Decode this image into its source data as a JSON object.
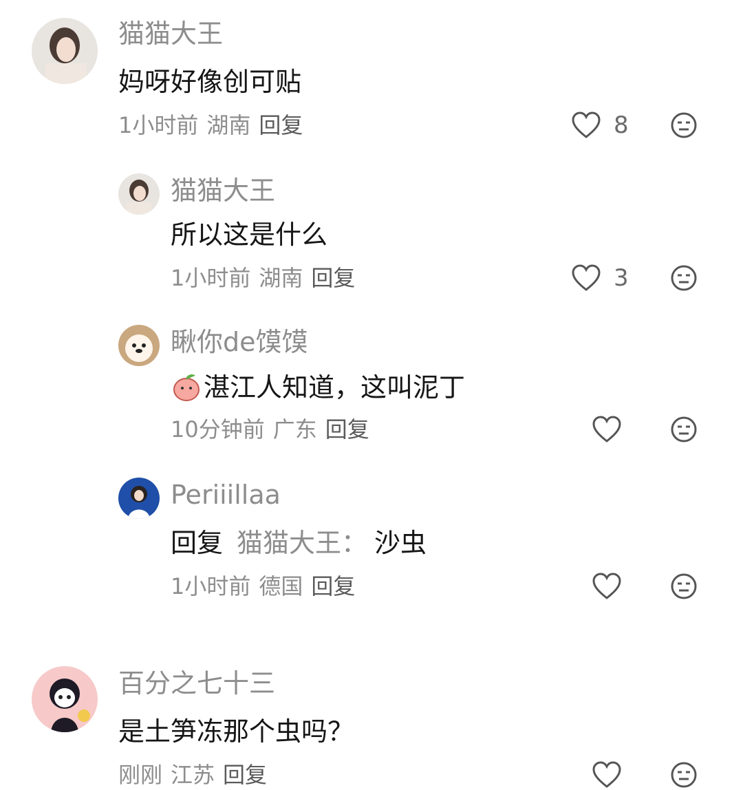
{
  "comments": [
    {
      "name": "猫猫大王",
      "text": "妈呀好像创可贴",
      "time": "1小时前",
      "location": "湖南",
      "reply_label": "回复",
      "likes": "8"
    },
    {
      "name": "猫猫大王",
      "text": "所以这是什么",
      "time": "1小时前",
      "location": "湖南",
      "reply_label": "回复",
      "likes": "3"
    },
    {
      "name": "瞅你de馍馍",
      "text": "湛江人知道，这叫泥丁",
      "time": "10分钟前",
      "location": "广东",
      "reply_label": "回复",
      "likes": ""
    },
    {
      "name": "Periiillaa",
      "reply_prefix": "回复",
      "reply_target": "猫猫大王：",
      "text": "沙虫",
      "time": "1小时前",
      "location": "德国",
      "reply_label": "回复",
      "likes": ""
    },
    {
      "name": "百分之七十三",
      "text": "是土笋冻那个虫吗？",
      "time": "刚刚",
      "location": "江苏",
      "reply_label": "回复",
      "likes": ""
    }
  ],
  "colors": {
    "secondary_text": "#8d8d8d",
    "primary_text": "#161616",
    "icon_stroke": "#555555"
  },
  "icons": [
    "heart-outline-icon",
    "dislike-face-icon",
    "peach-emoji-icon"
  ]
}
